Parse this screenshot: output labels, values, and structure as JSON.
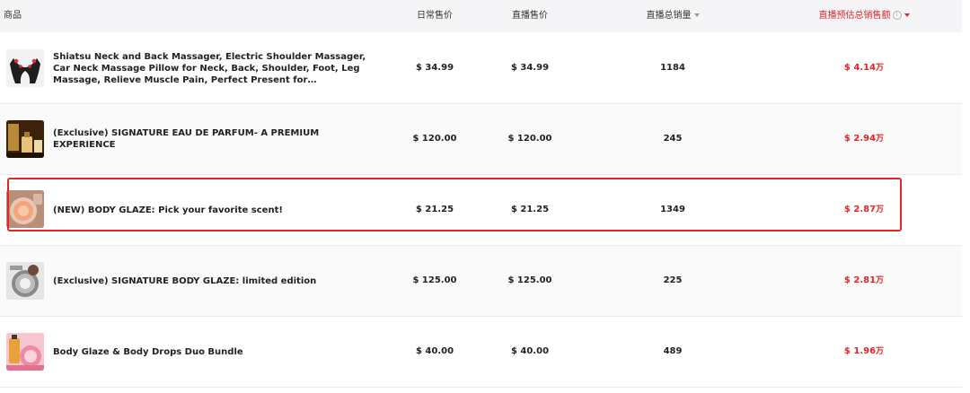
{
  "header": {
    "product": "商品",
    "daily_price": "日常售价",
    "live_price": "直播售价",
    "live_sales": "直播总销量",
    "live_gmv": "直播预估总销售额"
  },
  "rows": [
    {
      "name": "Shiatsu Neck and Back Massager, Electric Shoulder Massager, Car Neck Massage Pillow for Neck, Back, Shoulder, Foot, Leg Massage, Relieve Muscle Pain, Perfect Present for Man/Woman/Family, Thanksgiving,...",
      "daily_price": "$ 34.99",
      "live_price": "$ 34.99",
      "sales": "1184",
      "gmv": "$ 4.14",
      "gmv_unit": "万",
      "thumb_icon": "neck-massager-thumb"
    },
    {
      "name": "(Exclusive) SIGNATURE EAU DE PARFUM- A PREMIUM EXPERIENCE",
      "daily_price": "$ 120.00",
      "live_price": "$ 120.00",
      "sales": "245",
      "gmv": "$ 2.94",
      "gmv_unit": "万",
      "thumb_icon": "perfume-thumb"
    },
    {
      "name": "(NEW) BODY GLAZE: Pick your favorite scent!",
      "daily_price": "$ 21.25",
      "live_price": "$ 21.25",
      "sales": "1349",
      "gmv": "$ 2.87",
      "gmv_unit": "万",
      "thumb_icon": "body-glaze-jar-thumb"
    },
    {
      "name": "(Exclusive) SIGNATURE BODY GLAZE: limited edition",
      "daily_price": "$ 125.00",
      "live_price": "$ 125.00",
      "sales": "225",
      "gmv": "$ 2.81",
      "gmv_unit": "万",
      "thumb_icon": "limited-glaze-thumb"
    },
    {
      "name": "Body Glaze & Body Drops Duo Bundle",
      "daily_price": "$ 40.00",
      "live_price": "$ 40.00",
      "sales": "489",
      "gmv": "$ 1.96",
      "gmv_unit": "万",
      "thumb_icon": "duo-bundle-thumb"
    }
  ],
  "colors": {
    "accent_red": "#e0252b",
    "header_bg": "#f5f5f7",
    "row_alt_bg": "#fafafa"
  }
}
